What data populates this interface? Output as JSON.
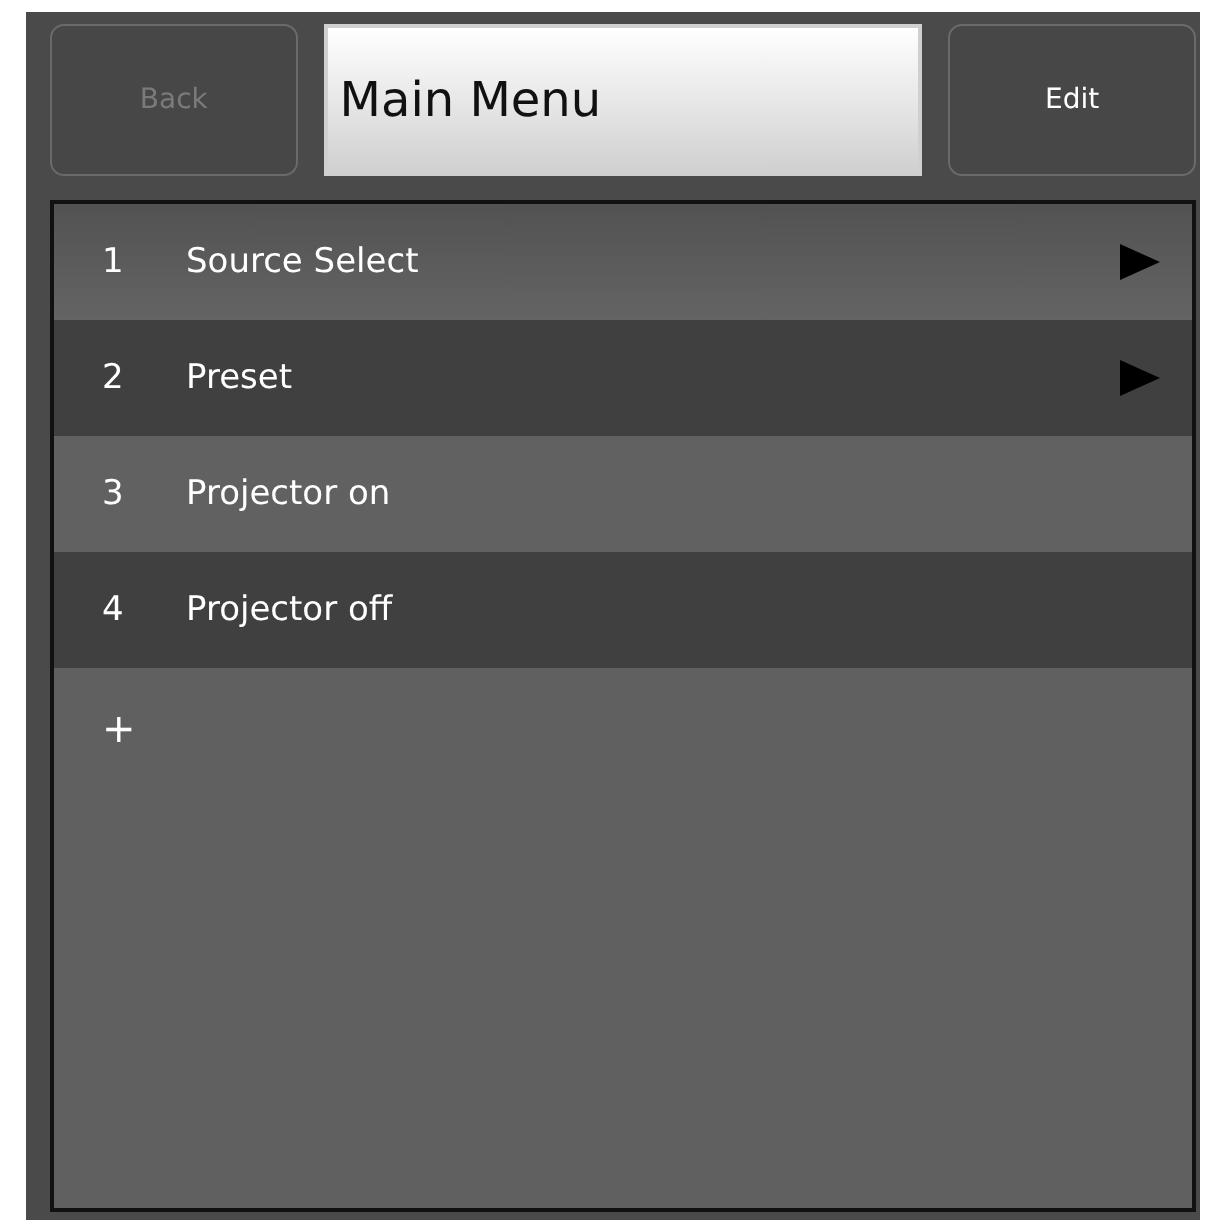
{
  "header": {
    "back_button": {
      "label": "Back",
      "disabled": true
    },
    "title": "Main Menu",
    "edit_button": {
      "label": "Edit",
      "disabled": false
    }
  },
  "menu_items": [
    {
      "number": "1",
      "label": "Source Select",
      "has_submenu": true
    },
    {
      "number": "2",
      "label": "Preset",
      "has_submenu": true
    },
    {
      "number": "3",
      "label": "Projector on",
      "has_submenu": false
    },
    {
      "number": "4",
      "label": "Projector off",
      "has_submenu": false
    }
  ],
  "add_symbol": "+"
}
